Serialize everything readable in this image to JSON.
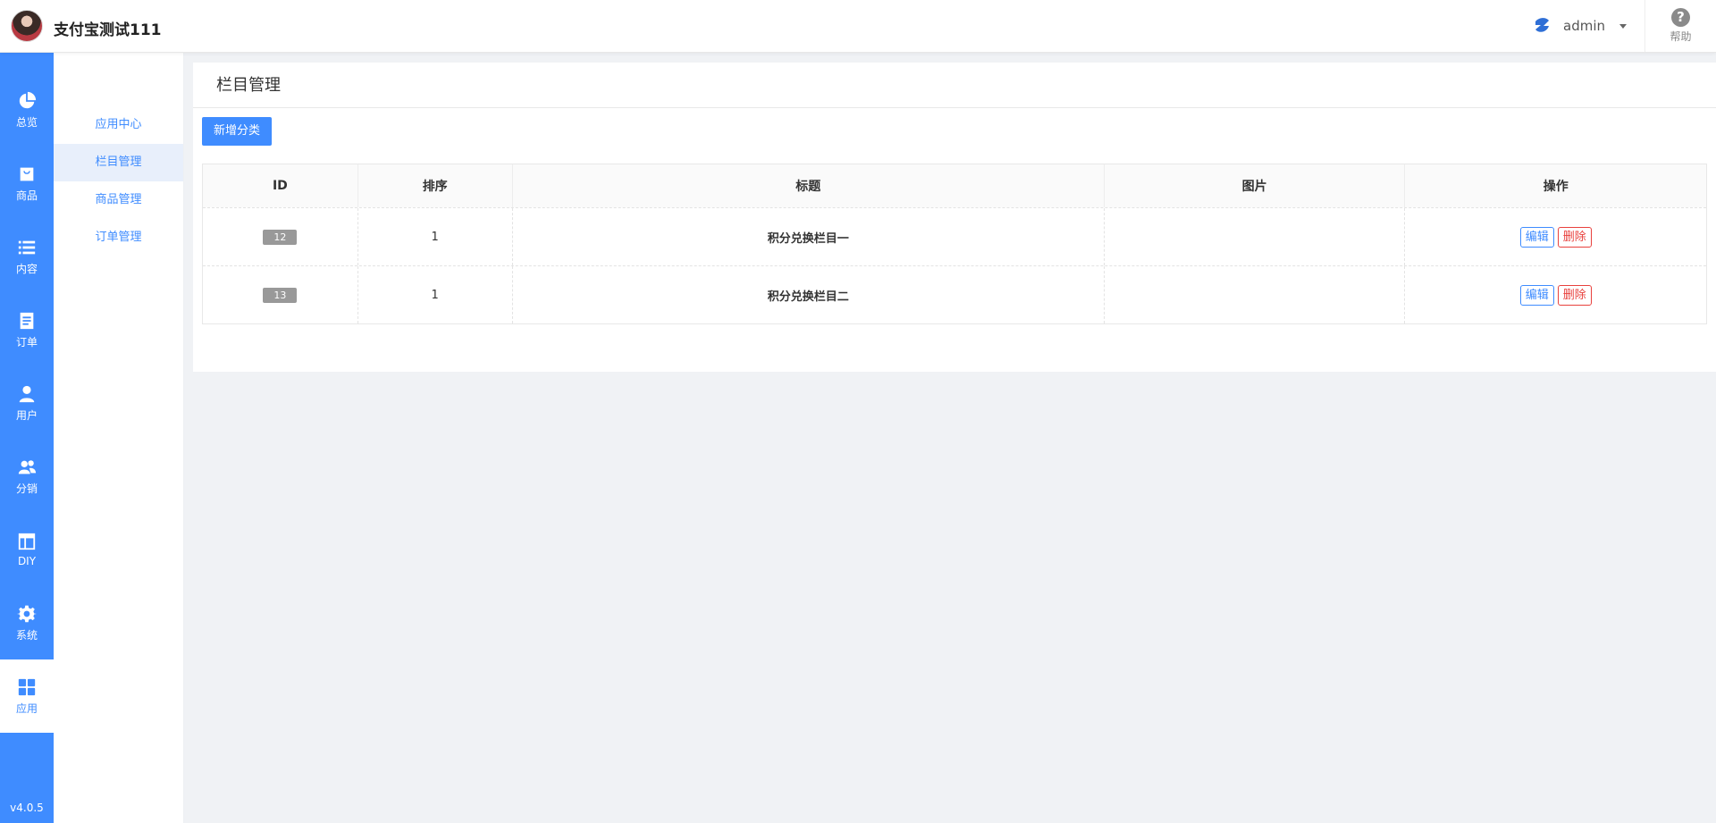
{
  "header": {
    "app_title": "支付宝测试111",
    "username": "admin",
    "help_label": "帮助"
  },
  "mainnav": {
    "items": [
      {
        "label": "总览",
        "icon": "pie-chart-icon"
      },
      {
        "label": "商品",
        "icon": "shopping-bag-icon"
      },
      {
        "label": "内容",
        "icon": "list-icon"
      },
      {
        "label": "订单",
        "icon": "order-document-icon"
      },
      {
        "label": "用户",
        "icon": "user-icon"
      },
      {
        "label": "分销",
        "icon": "users-group-icon"
      },
      {
        "label": "DIY",
        "icon": "layout-icon"
      },
      {
        "label": "系统",
        "icon": "gear-icon"
      },
      {
        "label": "应用",
        "icon": "apps-grid-icon"
      }
    ],
    "active": "应用",
    "version": "v4.0.5"
  },
  "subnav": {
    "items": [
      {
        "label": "应用中心"
      },
      {
        "label": "栏目管理"
      },
      {
        "label": "商品管理"
      },
      {
        "label": "订单管理"
      }
    ],
    "active": "栏目管理"
  },
  "main": {
    "page_title": "栏目管理",
    "add_button": "新增分类",
    "table": {
      "columns": [
        "ID",
        "排序",
        "标题",
        "图片",
        "操作"
      ],
      "rows": [
        {
          "id": "12",
          "sort": "1",
          "title": "积分兑换栏目一",
          "image": ""
        },
        {
          "id": "13",
          "sort": "1",
          "title": "积分兑换栏目二",
          "image": ""
        }
      ],
      "edit_label": "编辑",
      "delete_label": "删除"
    }
  },
  "colors": {
    "brand": "#3f8cff",
    "danger": "#e8413d",
    "background": "#f0f2f5"
  }
}
